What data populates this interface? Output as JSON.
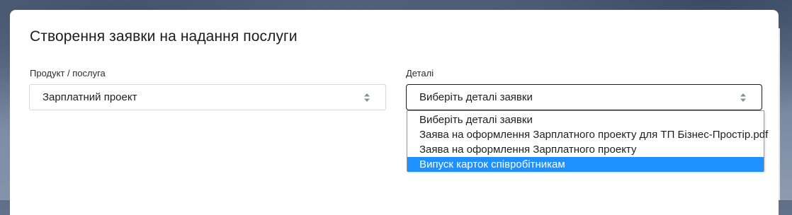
{
  "form": {
    "title": "Створення заявки на надання послуги",
    "product": {
      "label": "Продукт / послуга",
      "value": "Зарплатний проект"
    },
    "details": {
      "label": "Деталі",
      "value": "Виберіть деталі заявки",
      "options": [
        "Виберіть деталі заявки",
        "Заява на оформлення Зарплатного проекту для ТП Бізнес-Простір.pdf",
        "Заява на оформлення Зарплатного проекту",
        "Випуск карток співробітникам"
      ],
      "highlighted_index": 3
    }
  },
  "colors": {
    "highlight": "#1e90ff",
    "border": "#d4d7db",
    "text": "#1e1e1e"
  },
  "icons": {
    "select_arrows": "sort-arrows-icon"
  }
}
